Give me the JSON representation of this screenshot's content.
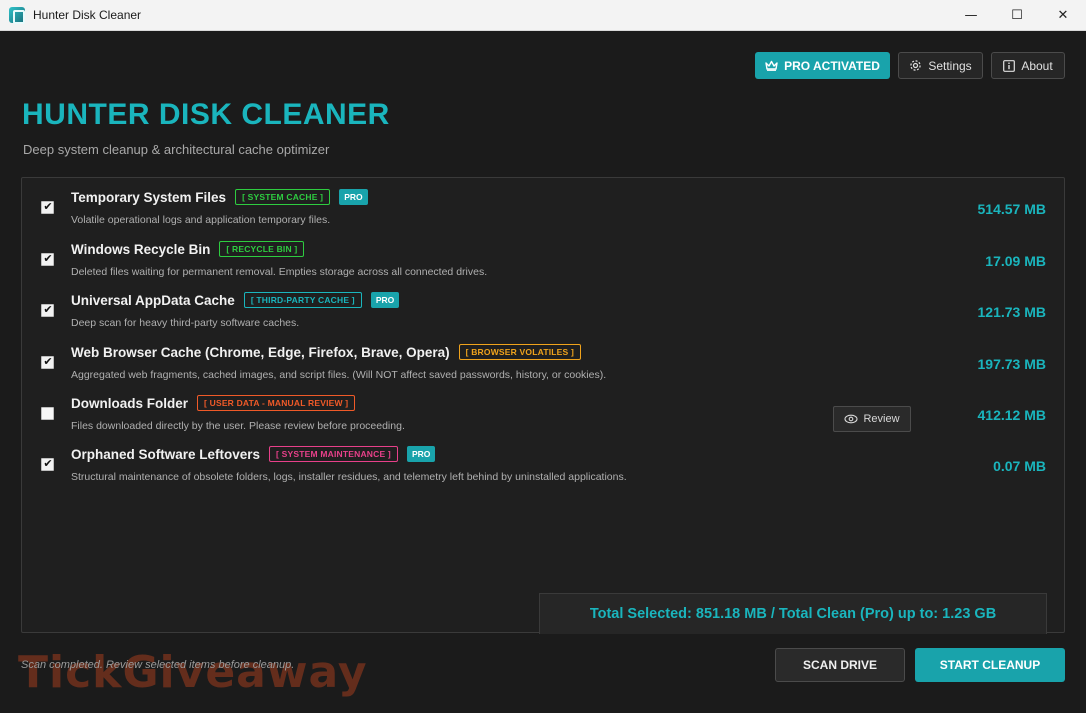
{
  "window": {
    "title": "Hunter Disk Cleaner",
    "minimize": "—",
    "maximize": "☐",
    "close": "✕"
  },
  "header": {
    "pro_label": "PRO ACTIVATED",
    "settings_label": "Settings",
    "about_label": "About",
    "title": "HUNTER DISK CLEANER",
    "subtitle": "Deep system cleanup & architectural cache optimizer"
  },
  "items": [
    {
      "title": "Temporary System Files",
      "tag": "[ SYSTEM CACHE ]",
      "tag_color": "#2ecc40",
      "pro": "PRO",
      "desc": "Volatile operational logs and application temporary files.",
      "size": "514.57 MB",
      "checked": true
    },
    {
      "title": "Windows Recycle Bin",
      "tag": "[ RECYCLE BIN ]",
      "tag_color": "#2ecc40",
      "pro": "",
      "desc": "Deleted files waiting for permanent removal. Empties storage across all connected drives.",
      "size": "17.09 MB",
      "checked": true
    },
    {
      "title": "Universal AppData Cache",
      "tag": "[ THIRD-PARTY CACHE ]",
      "tag_color": "#1ab5bd",
      "pro": "PRO",
      "desc": "Deep scan for heavy third-party software caches.",
      "size": "121.73 MB",
      "checked": true
    },
    {
      "title": "Web Browser Cache (Chrome, Edge, Firefox, Brave, Opera)",
      "tag": "[ BROWSER VOLATILES ]",
      "tag_color": "#f0a31c",
      "pro": "",
      "desc": "Aggregated web fragments, cached images, and script files. (Will NOT affect saved passwords, history, or cookies).",
      "size": "197.73 MB",
      "checked": true
    },
    {
      "title": "Downloads Folder",
      "tag": "[ USER DATA - MANUAL REVIEW ]",
      "tag_color": "#f05a28",
      "pro": "",
      "desc": "Files downloaded directly by the user. Please review before proceeding.",
      "size": "412.12 MB",
      "checked": false,
      "review_label": "Review"
    },
    {
      "title": "Orphaned Software Leftovers",
      "tag": "[ SYSTEM MAINTENANCE ]",
      "tag_color": "#e8408a",
      "pro": "PRO",
      "desc": "Structural maintenance of obsolete folders, logs, installer residues, and telemetry left behind by uninstalled applications.",
      "size": "0.07 MB",
      "checked": true
    }
  ],
  "total": "Total Selected: 851.18 MB / Total Clean (Pro) up to: 1.23 GB",
  "footer": {
    "status": "Scan completed. Review selected items before cleanup.",
    "watermark": "TickGiveaway",
    "scan_label": "SCAN DRIVE",
    "clean_label": "START CLEANUP"
  },
  "colors": {
    "accent": "#19a3ab",
    "accent_text": "#1ab5bd",
    "background": "#1b1b1b"
  }
}
